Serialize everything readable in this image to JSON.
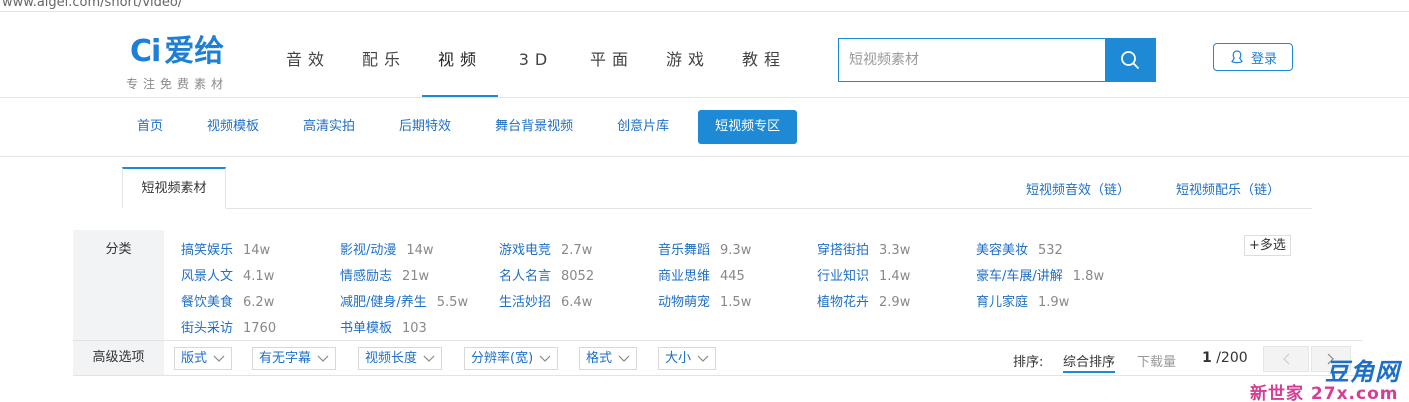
{
  "browser": {
    "url": "www.aigei.com/short/video/"
  },
  "logo": {
    "mark": "Ci",
    "name": "爱给",
    "slogan": "专注免费素材"
  },
  "main_nav": [
    {
      "label": "音效"
    },
    {
      "label": "配乐"
    },
    {
      "label": "视频"
    },
    {
      "label": "3D"
    },
    {
      "label": "平面"
    },
    {
      "label": "游戏"
    },
    {
      "label": "教程"
    }
  ],
  "search": {
    "placeholder": "短视频素材"
  },
  "login": {
    "label": "登录"
  },
  "sub_nav": [
    {
      "label": "首页"
    },
    {
      "label": "视频模板"
    },
    {
      "label": "高清实拍"
    },
    {
      "label": "后期特效"
    },
    {
      "label": "舞台背景视频"
    },
    {
      "label": "创意片库"
    },
    {
      "label": "短视频专区"
    }
  ],
  "tabs": {
    "active": "短视频素材",
    "links": [
      {
        "label": "短视频音效（链）"
      },
      {
        "label": "短视频配乐（链）"
      }
    ]
  },
  "filter": {
    "label": "分类",
    "multi_select": "+多选",
    "categories": [
      {
        "name": "搞笑娱乐",
        "count": "14w"
      },
      {
        "name": "影视/动漫",
        "count": "14w"
      },
      {
        "name": "游戏电竞",
        "count": "2.7w"
      },
      {
        "name": "音乐舞蹈",
        "count": "9.3w"
      },
      {
        "name": "穿搭街拍",
        "count": "3.3w"
      },
      {
        "name": "美容美妆",
        "count": "532"
      },
      {
        "name": "风景人文",
        "count": "4.1w"
      },
      {
        "name": "情感励志",
        "count": "21w"
      },
      {
        "name": "名人名言",
        "count": "8052"
      },
      {
        "name": "商业思维",
        "count": "445"
      },
      {
        "name": "行业知识",
        "count": "1.4w"
      },
      {
        "name": "豪车/车展/讲解",
        "count": "1.8w"
      },
      {
        "name": "餐饮美食",
        "count": "6.2w"
      },
      {
        "name": "减肥/健身/养生",
        "count": "5.5w"
      },
      {
        "name": "生活妙招",
        "count": "6.4w"
      },
      {
        "name": "动物萌宠",
        "count": "1.5w"
      },
      {
        "name": "植物花卉",
        "count": "2.9w"
      },
      {
        "name": "育儿家庭",
        "count": "1.9w"
      },
      {
        "name": "街头采访",
        "count": "1760"
      },
      {
        "name": "书单模板",
        "count": "103"
      }
    ]
  },
  "advanced": {
    "label": "高级选项",
    "dropdowns": [
      {
        "label": "版式"
      },
      {
        "label": "有无字幕"
      },
      {
        "label": "视频长度"
      },
      {
        "label": "分辨率(宽)"
      },
      {
        "label": "格式"
      },
      {
        "label": "大小"
      }
    ],
    "sort_label": "排序:",
    "sort_active": "综合排序",
    "sort_other": "下载量",
    "page_current": "1",
    "page_total": "/200"
  },
  "watermark": {
    "line1": "豆角网",
    "line2": "新世家 27x.com"
  },
  "colors": {
    "accent": "#1e8ad6",
    "link": "#1e6fc8",
    "label_bg": "#f2f3f5"
  }
}
